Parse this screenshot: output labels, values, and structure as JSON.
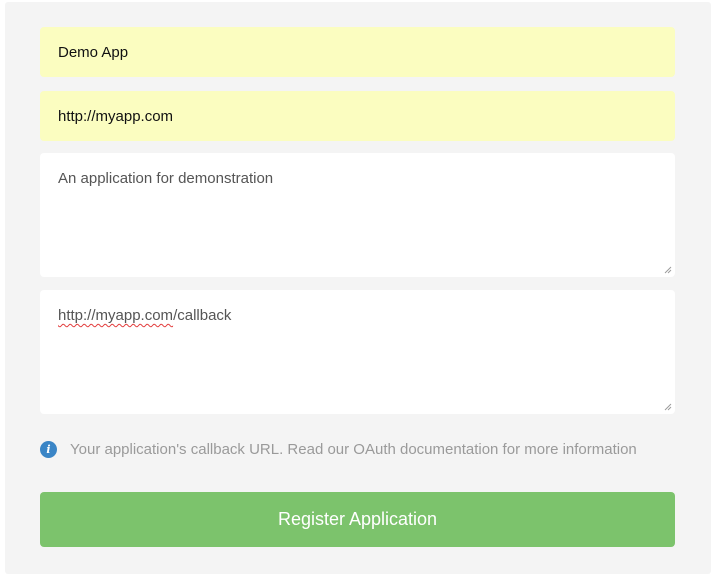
{
  "form": {
    "app_name": {
      "value": "Demo App"
    },
    "homepage_url": {
      "value": "http://myapp.com"
    },
    "description": {
      "value": "An application for demonstration"
    },
    "callback": {
      "value_misspelled_part": "http://myapp.com",
      "value_rest": "/callback"
    },
    "hint": {
      "icon": "info-icon",
      "icon_glyph": "i",
      "text": "Your application's callback URL. Read our OAuth documentation for more information"
    },
    "submit_label": "Register Application"
  },
  "colors": {
    "panel_bg": "#f4f4f4",
    "autofill_yellow": "#fbfdc0",
    "info_blue": "#3a85c6",
    "submit_green": "#7cc36c",
    "hint_text": "#9a9a9a"
  }
}
